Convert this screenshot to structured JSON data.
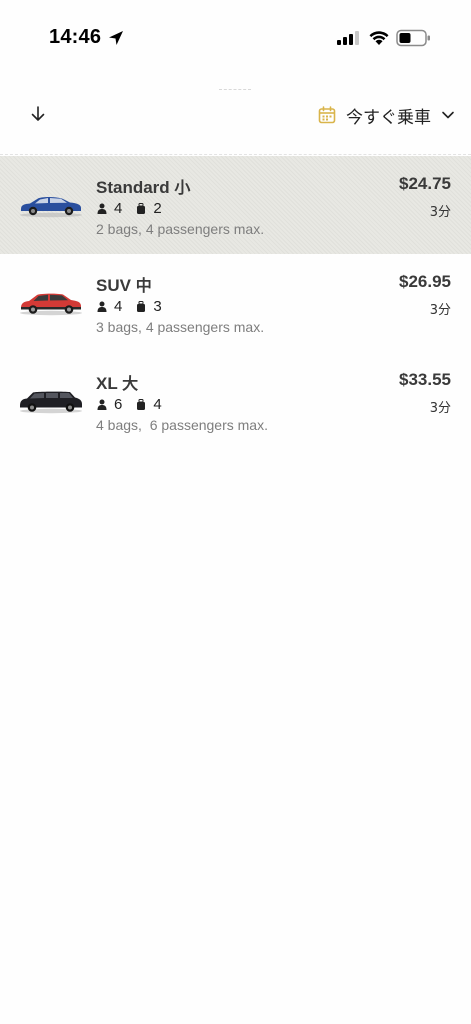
{
  "status_bar": {
    "time": "14:46",
    "icons": [
      "location-arrow-icon",
      "cellular-signal-icon",
      "wifi-icon",
      "battery-icon"
    ]
  },
  "header": {
    "back_icon": "arrow-down-icon",
    "schedule_label": "今すぐ乗車",
    "calendar_icon": "calendar-icon",
    "calendar_color": "#d9b44a",
    "chevron_icon": "chevron-down-icon"
  },
  "rides": [
    {
      "name": "Standard",
      "size": "小",
      "passengers": "4",
      "bags": "2",
      "note": "2 bags, 4 passengers max.",
      "price": "$24.75",
      "eta": "3分",
      "car_color": "#2a4f9e",
      "selected": true
    },
    {
      "name": "SUV",
      "size": "中",
      "passengers": "4",
      "bags": "3",
      "note": "3 bags, 4 passengers max.",
      "price": "$26.95",
      "eta": "3分",
      "car_color": "#d33a36",
      "selected": false
    },
    {
      "name": "XL",
      "size": "大",
      "passengers": "6",
      "bags": "4",
      "note": "4 bags,  6 passengers max.",
      "price": "$33.55",
      "eta": "3分",
      "car_color": "#1f1f24",
      "selected": false
    }
  ]
}
